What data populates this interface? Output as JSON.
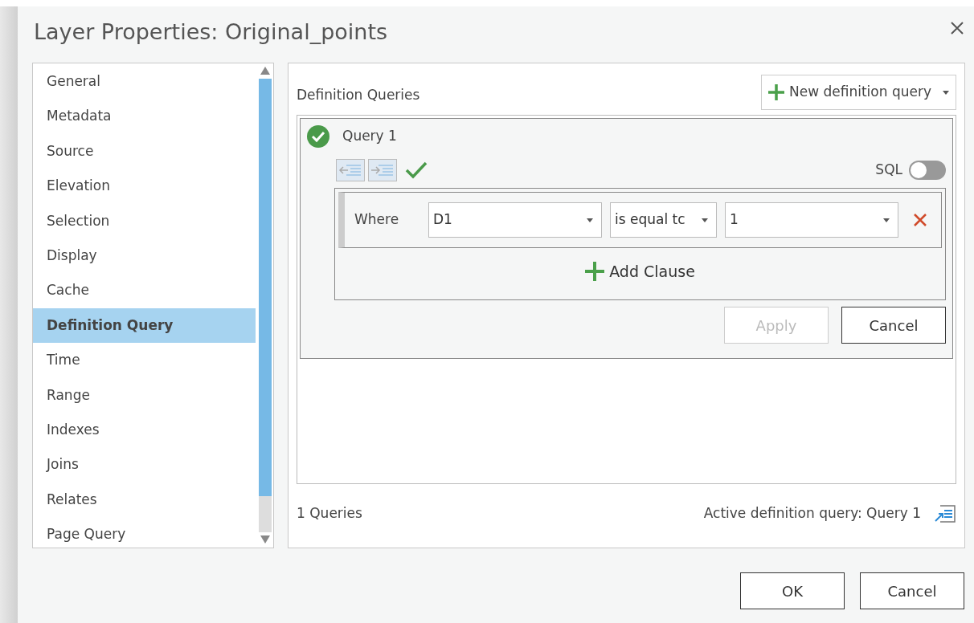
{
  "window": {
    "title": "Layer Properties: Original_points"
  },
  "sidebar": {
    "items": [
      {
        "label": "General",
        "selected": false
      },
      {
        "label": "Metadata",
        "selected": false
      },
      {
        "label": "Source",
        "selected": false
      },
      {
        "label": "Elevation",
        "selected": false
      },
      {
        "label": "Selection",
        "selected": false
      },
      {
        "label": "Display",
        "selected": false
      },
      {
        "label": "Cache",
        "selected": false
      },
      {
        "label": "Definition Query",
        "selected": true
      },
      {
        "label": "Time",
        "selected": false
      },
      {
        "label": "Range",
        "selected": false
      },
      {
        "label": "Indexes",
        "selected": false
      },
      {
        "label": "Joins",
        "selected": false
      },
      {
        "label": "Relates",
        "selected": false
      },
      {
        "label": "Page Query",
        "selected": false
      }
    ]
  },
  "panel": {
    "heading": "Definition Queries",
    "new_button": "New definition query",
    "query": {
      "name": "Query 1",
      "valid": true,
      "sql_on": false,
      "sql_label": "SQL",
      "clauses": [
        {
          "keyword": "Where",
          "field": "D1",
          "operator": "is equal tc",
          "value": "1"
        }
      ],
      "add_clause": "Add Clause",
      "buttons": [
        {
          "label": "Apply",
          "disabled": true
        },
        {
          "label": "Cancel",
          "disabled": false
        }
      ]
    },
    "count": "1 Queries",
    "active": "Active definition query: Query 1"
  },
  "buttons": [
    "OK",
    "Cancel"
  ]
}
